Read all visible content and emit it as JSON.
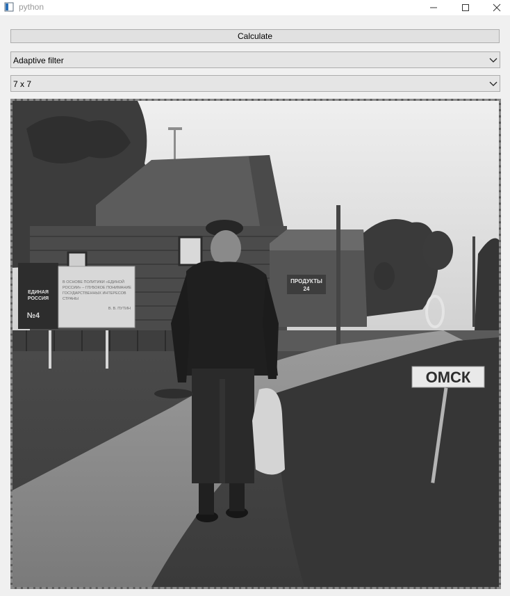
{
  "window": {
    "title": "python",
    "controls": {
      "minimize_icon": "minimize-icon",
      "maximize_icon": "maximize-icon",
      "close_icon": "close-icon"
    }
  },
  "toolbar": {
    "calculate_label": "Calculate"
  },
  "filter_select": {
    "value": "Adaptive filter"
  },
  "kernel_select": {
    "value": "7 x 7"
  },
  "image": {
    "description_icon": "processed-photo",
    "sign_omsk": "ОМСК",
    "sign_shop": "ПРОДУКТЫ\n24",
    "billboard_party": "ЕДИНАЯ\nРОССИЯ",
    "billboard_number": "№4",
    "billboard_quote": "В ОСНОВЕ ПОЛИТИКИ «ЕДИНОЙ РОССИИ» – ГЛУБОКОЕ ПОНИМАНИЕ ГОСУДАРСТВЕННЫХ ИНТЕРЕСОВ СТРАНЫ",
    "billboard_author": "В. В. ПУТИН"
  },
  "colors": {
    "window_bg": "#f0f0f0",
    "titlebar_bg": "#ffffff",
    "button_bg": "#e1e1e1",
    "button_border": "#adadad",
    "frame_border": "#8a8a8a"
  }
}
